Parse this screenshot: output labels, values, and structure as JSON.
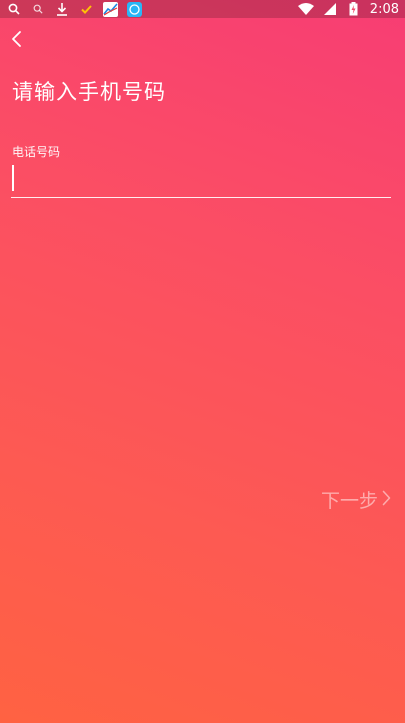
{
  "status_bar": {
    "time": "2:08",
    "left_icons": [
      "search-icon",
      "search-small-icon",
      "download-icon",
      "check-icon",
      "chart-app-icon",
      "browser-app-icon"
    ],
    "right_icons": [
      "wifi-icon",
      "signal-icon",
      "battery-charging-icon"
    ],
    "chart_app_color": "#1e88e5",
    "browser_app_color": "#29b6f6"
  },
  "header": {
    "back_icon": "chevron-left-icon"
  },
  "main": {
    "title": "请输入手机号码",
    "phone_label": "电话号码",
    "phone_value": "",
    "next_label": "下一步",
    "next_icon": "chevron-right-icon"
  },
  "colors": {
    "gradient_top": "#f73d74",
    "gradient_bottom": "#ff6242",
    "text": "#ffffff"
  }
}
